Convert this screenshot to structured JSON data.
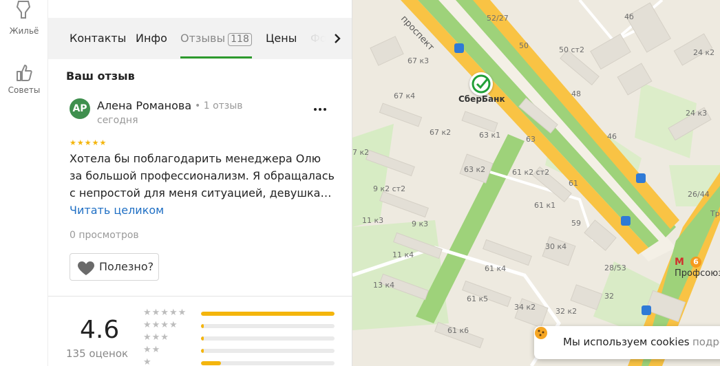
{
  "rail": {
    "items": [
      {
        "label": "Жильё",
        "icon": "building-icon"
      },
      {
        "label": "Советы",
        "icon": "thumbs-up-icon"
      }
    ]
  },
  "tabs": {
    "items": [
      {
        "label": "Контакты"
      },
      {
        "label": "Инфо"
      },
      {
        "label": "Отзывы",
        "count": "118",
        "active": true
      },
      {
        "label": "Цены"
      },
      {
        "label": "Фо"
      }
    ],
    "accent": "#2c9a2c"
  },
  "review": {
    "section_title": "Ваш отзыв",
    "avatar_initials": "АР",
    "avatar_color": "#3f8f4e",
    "author": "Алена Романова",
    "author_meta": "• 1 отзыв",
    "date": "сегодня",
    "rating_stars": 5,
    "text": "Хотела бы поблагодарить менеджера Олю за большой профессионализм. Я обращалась с непростой для меня ситуацией, девушка…",
    "read_more": "Читать целиком",
    "views": "0 просмотров",
    "useful_label": "Полезно?"
  },
  "rating_summary": {
    "value": "4.6",
    "count_label": "135 оценок",
    "distribution": [
      {
        "stars": 5,
        "fraction": 1.0
      },
      {
        "stars": 4,
        "fraction": 0.02
      },
      {
        "stars": 3,
        "fraction": 0.02
      },
      {
        "stars": 2,
        "fraction": 0.02
      },
      {
        "stars": 1,
        "fraction": 0.15
      }
    ]
  },
  "map": {
    "street": "проспект",
    "poi": {
      "label": "СберБанк",
      "icon": "sberbank-logo-icon",
      "color": "#21a038"
    },
    "metro": {
      "letter": "М",
      "line": "6",
      "station": "Профсоюзная",
      "line_color": "#f59a1e"
    },
    "house_labels": [
      "52/27",
      "4б",
      "50",
      "50 ст2",
      "24 к2",
      "67 к3",
      "48",
      "67 к4",
      "24 к3",
      "67 к2",
      "63 к1",
      "46",
      "63",
      "7 к2",
      "63 к2",
      "61 к2 ст2",
      "9 к2 ст2",
      "61",
      "26/44",
      "61 к1",
      "11 к3",
      "9 к3",
      "59",
      "30 к4",
      "11 к4",
      "28/53",
      "61 к4",
      "13 к4",
      "32",
      "61 к5",
      "34 к2",
      "32 к2",
      "61 к6",
      "Тр"
    ]
  },
  "cookie": {
    "text": "Мы используем cookies",
    "link": "подро"
  }
}
